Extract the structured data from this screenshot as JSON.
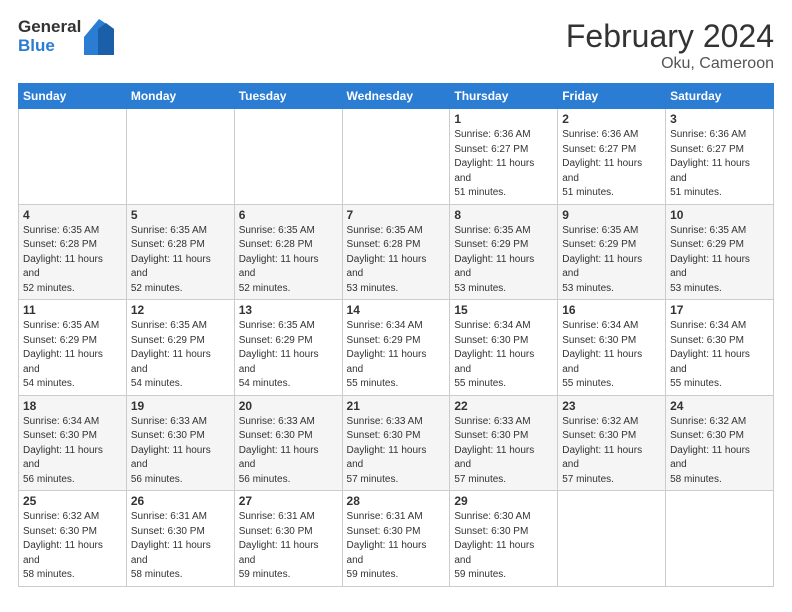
{
  "logo": {
    "general": "General",
    "blue": "Blue"
  },
  "header": {
    "month": "February 2024",
    "location": "Oku, Cameroon"
  },
  "weekdays": [
    "Sunday",
    "Monday",
    "Tuesday",
    "Wednesday",
    "Thursday",
    "Friday",
    "Saturday"
  ],
  "weeks": [
    [
      {
        "day": null
      },
      {
        "day": null
      },
      {
        "day": null
      },
      {
        "day": null
      },
      {
        "day": 1,
        "sunrise": "6:36 AM",
        "sunset": "6:27 PM",
        "daylight": "11 hours and 51 minutes."
      },
      {
        "day": 2,
        "sunrise": "6:36 AM",
        "sunset": "6:27 PM",
        "daylight": "11 hours and 51 minutes."
      },
      {
        "day": 3,
        "sunrise": "6:36 AM",
        "sunset": "6:27 PM",
        "daylight": "11 hours and 51 minutes."
      }
    ],
    [
      {
        "day": 4,
        "sunrise": "6:35 AM",
        "sunset": "6:28 PM",
        "daylight": "11 hours and 52 minutes."
      },
      {
        "day": 5,
        "sunrise": "6:35 AM",
        "sunset": "6:28 PM",
        "daylight": "11 hours and 52 minutes."
      },
      {
        "day": 6,
        "sunrise": "6:35 AM",
        "sunset": "6:28 PM",
        "daylight": "11 hours and 52 minutes."
      },
      {
        "day": 7,
        "sunrise": "6:35 AM",
        "sunset": "6:28 PM",
        "daylight": "11 hours and 53 minutes."
      },
      {
        "day": 8,
        "sunrise": "6:35 AM",
        "sunset": "6:29 PM",
        "daylight": "11 hours and 53 minutes."
      },
      {
        "day": 9,
        "sunrise": "6:35 AM",
        "sunset": "6:29 PM",
        "daylight": "11 hours and 53 minutes."
      },
      {
        "day": 10,
        "sunrise": "6:35 AM",
        "sunset": "6:29 PM",
        "daylight": "11 hours and 53 minutes."
      }
    ],
    [
      {
        "day": 11,
        "sunrise": "6:35 AM",
        "sunset": "6:29 PM",
        "daylight": "11 hours and 54 minutes."
      },
      {
        "day": 12,
        "sunrise": "6:35 AM",
        "sunset": "6:29 PM",
        "daylight": "11 hours and 54 minutes."
      },
      {
        "day": 13,
        "sunrise": "6:35 AM",
        "sunset": "6:29 PM",
        "daylight": "11 hours and 54 minutes."
      },
      {
        "day": 14,
        "sunrise": "6:34 AM",
        "sunset": "6:29 PM",
        "daylight": "11 hours and 55 minutes."
      },
      {
        "day": 15,
        "sunrise": "6:34 AM",
        "sunset": "6:30 PM",
        "daylight": "11 hours and 55 minutes."
      },
      {
        "day": 16,
        "sunrise": "6:34 AM",
        "sunset": "6:30 PM",
        "daylight": "11 hours and 55 minutes."
      },
      {
        "day": 17,
        "sunrise": "6:34 AM",
        "sunset": "6:30 PM",
        "daylight": "11 hours and 55 minutes."
      }
    ],
    [
      {
        "day": 18,
        "sunrise": "6:34 AM",
        "sunset": "6:30 PM",
        "daylight": "11 hours and 56 minutes."
      },
      {
        "day": 19,
        "sunrise": "6:33 AM",
        "sunset": "6:30 PM",
        "daylight": "11 hours and 56 minutes."
      },
      {
        "day": 20,
        "sunrise": "6:33 AM",
        "sunset": "6:30 PM",
        "daylight": "11 hours and 56 minutes."
      },
      {
        "day": 21,
        "sunrise": "6:33 AM",
        "sunset": "6:30 PM",
        "daylight": "11 hours and 57 minutes."
      },
      {
        "day": 22,
        "sunrise": "6:33 AM",
        "sunset": "6:30 PM",
        "daylight": "11 hours and 57 minutes."
      },
      {
        "day": 23,
        "sunrise": "6:32 AM",
        "sunset": "6:30 PM",
        "daylight": "11 hours and 57 minutes."
      },
      {
        "day": 24,
        "sunrise": "6:32 AM",
        "sunset": "6:30 PM",
        "daylight": "11 hours and 58 minutes."
      }
    ],
    [
      {
        "day": 25,
        "sunrise": "6:32 AM",
        "sunset": "6:30 PM",
        "daylight": "11 hours and 58 minutes."
      },
      {
        "day": 26,
        "sunrise": "6:31 AM",
        "sunset": "6:30 PM",
        "daylight": "11 hours and 58 minutes."
      },
      {
        "day": 27,
        "sunrise": "6:31 AM",
        "sunset": "6:30 PM",
        "daylight": "11 hours and 59 minutes."
      },
      {
        "day": 28,
        "sunrise": "6:31 AM",
        "sunset": "6:30 PM",
        "daylight": "11 hours and 59 minutes."
      },
      {
        "day": 29,
        "sunrise": "6:30 AM",
        "sunset": "6:30 PM",
        "daylight": "11 hours and 59 minutes."
      },
      {
        "day": null
      },
      {
        "day": null
      }
    ]
  ],
  "labels": {
    "sunrise": "Sunrise:",
    "sunset": "Sunset:",
    "daylight": "Daylight:"
  }
}
